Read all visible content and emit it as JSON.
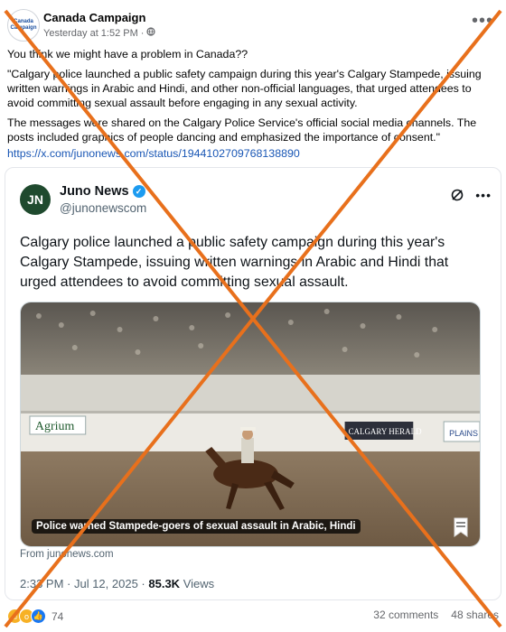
{
  "post": {
    "page_name": "Canada Campaign",
    "avatar_text": "Canada Campaign",
    "timestamp": "Yesterday at 1:52 PM",
    "separator": "·",
    "paragraph1": "You think we might have a problem in Canada??",
    "paragraph2": "\"Calgary police launched a public safety campaign during this year's Calgary Stampede, issuing written warnings in Arabic and Hindi, and other non-official languages, that urged attendees to avoid committing sexual assault before engaging in any sexual activity.",
    "paragraph3": "The messages were shared on the Calgary Police Service's official social media channels. The posts included graphics of people dancing and emphasized the importance of consent.\"",
    "link": "https://x.com/junonews.com/status/1944102709768138890"
  },
  "tweet": {
    "logo_text": "JN",
    "author_name": "Juno News",
    "handle": "@junonewscom",
    "text": "Calgary police launched a public safety campaign during this year's Calgary Stampede, issuing written warnings in Arabic and Hindi that urged attendees to avoid committing sexual assault.",
    "image_caption": "Police warned Stampede-goers of sexual assault in Arabic, Hindi",
    "image_signs": [
      "Agrium",
      "CALGARY HERALD",
      "PLAINS"
    ],
    "source": "From junonews.com",
    "time": "2:33 PM · Jul 12, 2025 ·",
    "views_count": "85.3K",
    "views_label": "Views"
  },
  "footer": {
    "reaction_count": "74",
    "comments": "32 comments",
    "shares": "48 shares"
  },
  "colors": {
    "cross": "#e8701c",
    "link": "#1a57b5",
    "verified": "#1d9bf0"
  },
  "icons": [
    "globe-icon",
    "more-icon",
    "grok-icon",
    "verified-icon",
    "bookmark-icon",
    "haha-icon",
    "wow-icon",
    "like-icon"
  ]
}
